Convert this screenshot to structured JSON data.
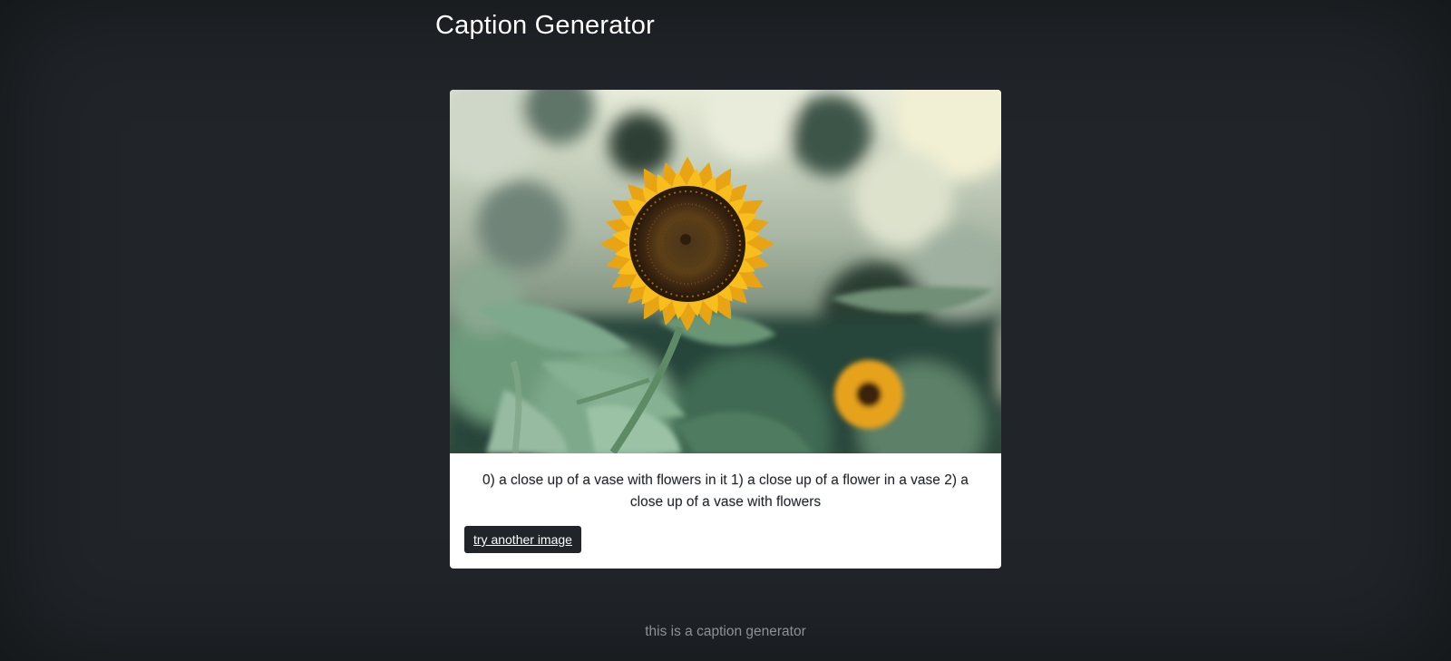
{
  "header": {
    "brand": "Caption Generator"
  },
  "card": {
    "image_alt": "sunflower-image",
    "caption": "0) a close up of a vase with flowers in it 1) a close up of a flower in a vase 2) a close up of a vase with flowers",
    "button_label": "try another image"
  },
  "footer": {
    "text": "this is a caption generator"
  },
  "colors": {
    "background": "#212529",
    "card": "#ffffff",
    "button": "#212529",
    "footer_text": "#8d9297"
  }
}
